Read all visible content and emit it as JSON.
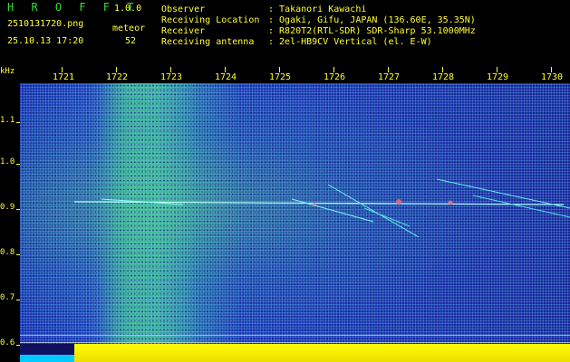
{
  "header": {
    "brand": "H R O F F T",
    "version": "1.0.0",
    "filename": "2510131720.png",
    "mode": "meteor",
    "timestamp": "25.10.13 17:20",
    "count": "52",
    "fields": [
      {
        "label": "Observer",
        "value": ": Takanori Kawachi"
      },
      {
        "label": "Receiving Location",
        "value": ": Ogaki, Gifu, JAPAN (136.60E, 35.35N)"
      },
      {
        "label": "Receiver",
        "value": ": R820T2(RTL-SDR) SDR-Sharp 53.1000MHz"
      },
      {
        "label": "Receiving antenna",
        "value": ": 2el-HB9CV Vertical (el. E-W)"
      }
    ]
  },
  "x_axis": {
    "ticks": [
      "1721",
      "1722",
      "1723",
      "1724",
      "1725",
      "1726",
      "1727",
      "1728",
      "1729",
      "1730"
    ]
  },
  "y_axis": {
    "unit": "kHz",
    "ticks": [
      "1.1",
      "1.0",
      "0.9",
      "0.8",
      "0.7",
      "0.6"
    ]
  },
  "colors": {
    "text_yellow": "#ffff33",
    "text_green": "#33dd33",
    "background": "#000000"
  }
}
